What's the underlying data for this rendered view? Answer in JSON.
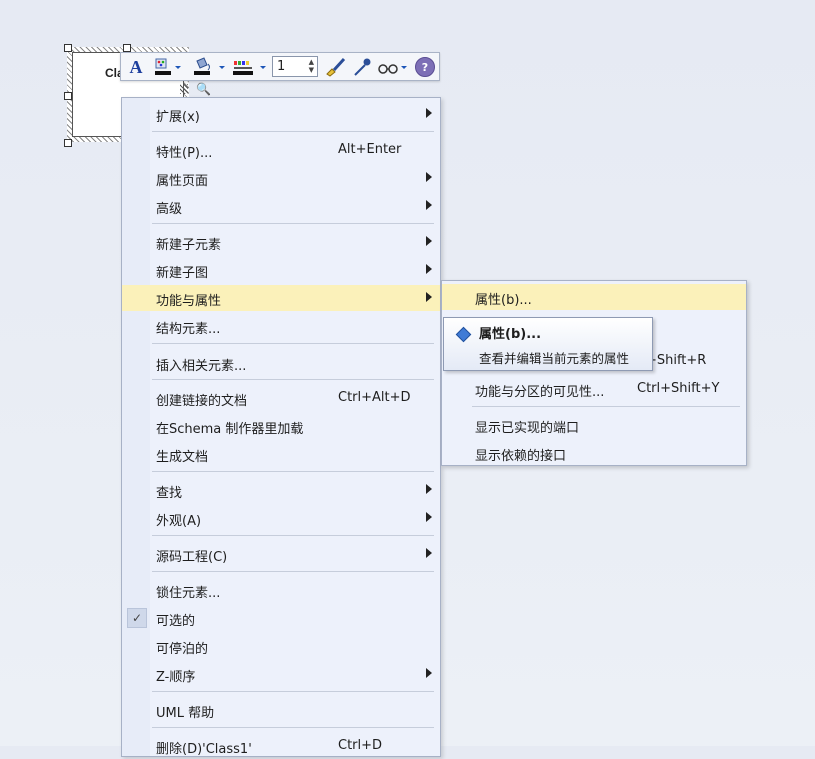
{
  "diagram": {
    "element_name": "Cla"
  },
  "toolbar": {
    "font_icon": "A",
    "line_width_value": "1",
    "help_icon": "?"
  },
  "menu": {
    "items": [
      {
        "label": "扩展(x)",
        "shortcut": "",
        "submenu": true
      },
      {
        "label": "特性(P)...",
        "shortcut": "Alt+Enter",
        "submenu": false
      },
      {
        "label": "属性页面",
        "shortcut": "",
        "submenu": true
      },
      {
        "label": "高级",
        "shortcut": "",
        "submenu": true
      },
      {
        "label": "新建子元素",
        "shortcut": "",
        "submenu": true
      },
      {
        "label": "新建子图",
        "shortcut": "",
        "submenu": true
      },
      {
        "label": "功能与属性",
        "shortcut": "",
        "submenu": true,
        "highlighted": true
      },
      {
        "label": "结构元素...",
        "shortcut": "",
        "submenu": false
      },
      {
        "label": "插入相关元素...",
        "shortcut": "",
        "submenu": false
      },
      {
        "label": "创建链接的文档",
        "shortcut": "Ctrl+Alt+D",
        "submenu": false
      },
      {
        "label": "在Schema 制作器里加载",
        "shortcut": "",
        "submenu": false
      },
      {
        "label": "生成文档",
        "shortcut": "",
        "submenu": false
      },
      {
        "label": "查找",
        "shortcut": "",
        "submenu": true
      },
      {
        "label": "外观(A)",
        "shortcut": "",
        "submenu": true
      },
      {
        "label": "源码工程(C)",
        "shortcut": "",
        "submenu": true
      },
      {
        "label": "锁住元素...",
        "shortcut": "",
        "submenu": false
      },
      {
        "label": "可选的",
        "shortcut": "",
        "submenu": false,
        "checked": true
      },
      {
        "label": "可停泊的",
        "shortcut": "",
        "submenu": false
      },
      {
        "label": "Z-顺序",
        "shortcut": "",
        "submenu": true
      },
      {
        "label": "UML 帮助",
        "shortcut": "",
        "submenu": false
      },
      {
        "label": "删除(D)'Class1'",
        "shortcut": "Ctrl+D",
        "submenu": false
      }
    ]
  },
  "submenu": {
    "items": [
      {
        "label": "属性(b)...",
        "shortcut": "",
        "highlighted": true
      },
      {
        "label": "",
        "shortcut": ""
      },
      {
        "label": "",
        "shortcut": "rl+Shift+R"
      },
      {
        "label": "功能与分区的可见性...",
        "shortcut": "Ctrl+Shift+Y"
      },
      {
        "label": "显示已实现的端口",
        "shortcut": ""
      },
      {
        "label": "显示依赖的接口",
        "shortcut": ""
      }
    ]
  },
  "tooltip": {
    "title": "属性(b)...",
    "description": "查看并编辑当前元素的属性"
  },
  "colors": {
    "highlight": "#fbf1ba",
    "menu_bg": "#edf1fb",
    "accent": "#3f7bd6"
  }
}
